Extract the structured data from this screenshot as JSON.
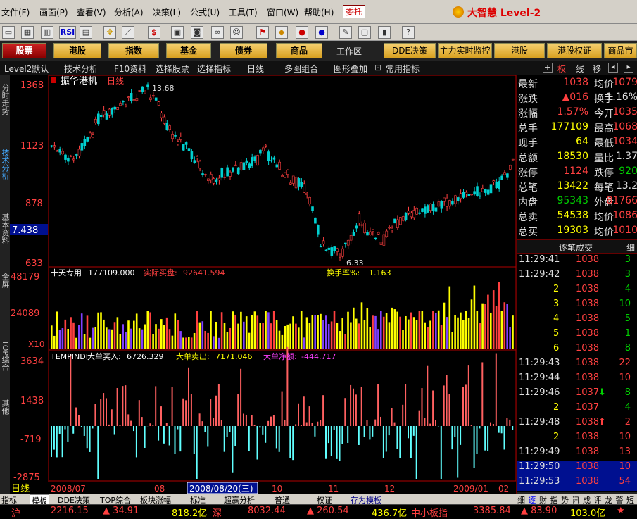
{
  "menubar": {
    "items": [
      "文件(F)",
      "画面(P)",
      "查看(V)",
      "分析(A)",
      "决策(L)",
      "公式(U)",
      "工具(T)",
      "窗口(W)",
      "帮助(H)"
    ],
    "entrust_label": "委托",
    "brand": "大智慧 Level-2"
  },
  "toolbar": {
    "rsi_label": "RSI",
    "s_label": "$"
  },
  "categories": {
    "items": [
      "股票",
      "港股",
      "指数",
      "基金",
      "债券",
      "商品"
    ],
    "workspace_label": "工作区",
    "right_items": [
      "DDE决策",
      "主力实时监控",
      "港股",
      "港股权证",
      "商品市"
    ]
  },
  "viewbar": {
    "items": [
      "Level2默认",
      "技术分析",
      "F10资料",
      "选择股票",
      "选择指标",
      "日线",
      "多图组合",
      "图形叠加",
      "常用指标"
    ],
    "right_tabs": [
      "权",
      "线",
      "移"
    ]
  },
  "side_tabs": [
    "分时走势",
    "技术分析",
    "基本资料",
    "全屏",
    "TOP综合",
    "其他"
  ],
  "main_chart": {
    "stock_name": "振华港机",
    "period": "日线",
    "y_ticks": [
      "1368",
      "1123",
      "878",
      "633"
    ],
    "cursor_value": "7.438",
    "high_marker": "13.68",
    "low_marker": "6.33"
  },
  "volume_chart": {
    "title": "十天专用",
    "value1": "177109.000",
    "label2": "实际买盘:",
    "value2": "92641.594",
    "label3": "换手率%:",
    "value3": "1.163",
    "y_ticks": [
      "48179",
      "24089"
    ],
    "unit": "X10"
  },
  "indicator_chart": {
    "title": "TEMPINDI",
    "buy_label": "大单买入:",
    "buy_value": "6726.329",
    "sell_label": "大单卖出:",
    "sell_value": "7171.046",
    "net_label": "大单净额:",
    "net_value": "-444.717",
    "y_ticks": [
      "3634",
      "1438",
      "-719",
      "-2875"
    ]
  },
  "date_axis": {
    "period": "日线",
    "labels": [
      "2008/07",
      "08",
      "2008/08/20(三)",
      "10",
      "11",
      "12",
      "2009/01",
      "02"
    ]
  },
  "quotes": [
    {
      "l": "最新",
      "v": "1038",
      "l2": "均价",
      "v2": "1079"
    },
    {
      "l": "涨跌",
      "v": "▲016",
      "l2": "换手",
      "v2": "1.16%"
    },
    {
      "l": "涨幅",
      "v": "1.57%",
      "l2": "今开",
      "v2": "1035"
    },
    {
      "l": "总手",
      "v": "177109",
      "l2": "最高",
      "v2": "1068"
    },
    {
      "l": "现手",
      "v": "64",
      "l2": "最低",
      "v2": "1034"
    },
    {
      "l": "总额",
      "v": "18530",
      "l2": "量比",
      "v2": "1.37"
    },
    {
      "l": "涨停",
      "v": "1124",
      "l2": "跌停",
      "v2": "920"
    },
    {
      "l": "总笔",
      "v": "13422",
      "l2": "每笔",
      "v2": "13.2"
    },
    {
      "l": "内盘",
      "v": "95343",
      "l2": "外盘",
      "v2": "81766"
    },
    {
      "l": "总卖",
      "v": "54538",
      "l2": "均价",
      "v2": "1086"
    },
    {
      "l": "总买",
      "v": "19303",
      "l2": "均价",
      "v2": "1010"
    }
  ],
  "ticks_header": {
    "title": "逐笔成交",
    "right": "细"
  },
  "ticks": [
    {
      "t": "11:29:41",
      "p": "1038",
      "v": "3",
      "dir": ""
    },
    {
      "t": "11:29:42",
      "p": "1038",
      "v": "3",
      "dir": ""
    },
    {
      "t": "2",
      "p": "1038",
      "v": "4",
      "dir": ""
    },
    {
      "t": "3",
      "p": "1038",
      "v": "10",
      "dir": ""
    },
    {
      "t": "4",
      "p": "1038",
      "v": "5",
      "dir": ""
    },
    {
      "t": "5",
      "p": "1038",
      "v": "1",
      "dir": ""
    },
    {
      "t": "6",
      "p": "1038",
      "v": "8",
      "dir": ""
    },
    {
      "t": "11:29:43",
      "p": "1038",
      "v": "22",
      "dir": ""
    },
    {
      "t": "11:29:44",
      "p": "1038",
      "v": "10",
      "dir": ""
    },
    {
      "t": "11:29:46",
      "p": "1037",
      "v": "8",
      "dir": "down"
    },
    {
      "t": "2",
      "p": "1037",
      "v": "4",
      "dir": ""
    },
    {
      "t": "11:29:48",
      "p": "1038",
      "v": "2",
      "dir": "up"
    },
    {
      "t": "2",
      "p": "1038",
      "v": "10",
      "dir": ""
    },
    {
      "t": "11:29:49",
      "p": "1038",
      "v": "13",
      "dir": ""
    },
    {
      "t": "11:29:50",
      "p": "1038",
      "v": "10",
      "dir": ""
    },
    {
      "t": "11:29:53",
      "p": "1038",
      "v": "54",
      "dir": ""
    }
  ],
  "panel_tabs": [
    "细",
    "逐",
    "财",
    "指",
    "势",
    "讯",
    "成",
    "评",
    "龙",
    "警",
    "短"
  ],
  "bottom_tabs": [
    "指标",
    "模板",
    "DDE决策",
    "TOP综合",
    "板块涨幅",
    "标准",
    "超赢分析",
    "普通",
    "权证",
    "存为模板"
  ],
  "status": {
    "sh_label": "沪",
    "sh_index": "2216.15",
    "sh_change": "▲ 34.91",
    "sh_amount": "818.2亿",
    "sz_label": "深",
    "sz_index": "8032.44",
    "sz_change": "▲ 260.54",
    "sz_amount": "436.7亿",
    "sme_label": "中小板指",
    "sme_index": "3385.84",
    "sme_change": "▲ 83.90",
    "sme_amount": "103.0亿"
  },
  "colors": {
    "up": "#ff4040",
    "down": "#00d0d0",
    "volume_up": "#ffff00",
    "text_yellow": "#ffff00",
    "frame": "#b00000"
  }
}
